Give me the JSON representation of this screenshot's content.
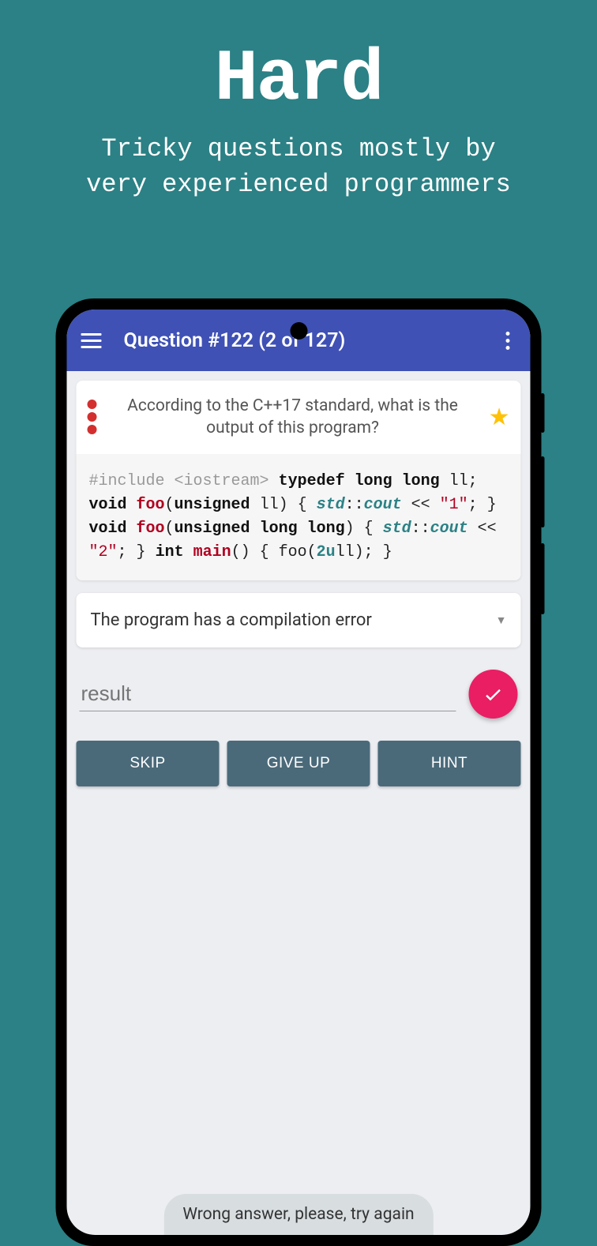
{
  "promo": {
    "title": "Hard",
    "subtitle_line1": "Tricky questions mostly by",
    "subtitle_line2": "very experienced programmers"
  },
  "appbar": {
    "title": "Question #122 (2 of 127)"
  },
  "question": {
    "prompt": "According to the C++17 standard, what is the output of this program?"
  },
  "code": {
    "include": "#include <iostream>",
    "typedef_kw": "typedef long long",
    "typedef_rest": " ll;",
    "foo1_sig1": "void ",
    "foo1_name": "foo",
    "foo1_sig2": "(",
    "foo1_kw": "unsigned",
    "foo1_sig3": " ll) {",
    "cout_ns": "std",
    "cout_rest": "::",
    "cout_fn": "cout",
    "cout_op": " << ",
    "str1": "\"1\"",
    "semi": ";",
    "close": "}",
    "foo2_sig2": "(",
    "foo2_kw": "unsigned long long",
    "foo2_sig3": ") {",
    "str2": "\"2\"",
    "main_kw": "int ",
    "main_name": "main",
    "main_sig": "() {",
    "call_indent": "    foo(",
    "call_num": "2u",
    "call_rest": "ll);"
  },
  "dropdown": {
    "selected": "The program has a compilation error"
  },
  "input": {
    "placeholder": "result"
  },
  "buttons": {
    "skip": "SKIP",
    "giveup": "GIVE UP",
    "hint": "HINT"
  },
  "toast": {
    "message": "Wrong answer, please, try again"
  }
}
